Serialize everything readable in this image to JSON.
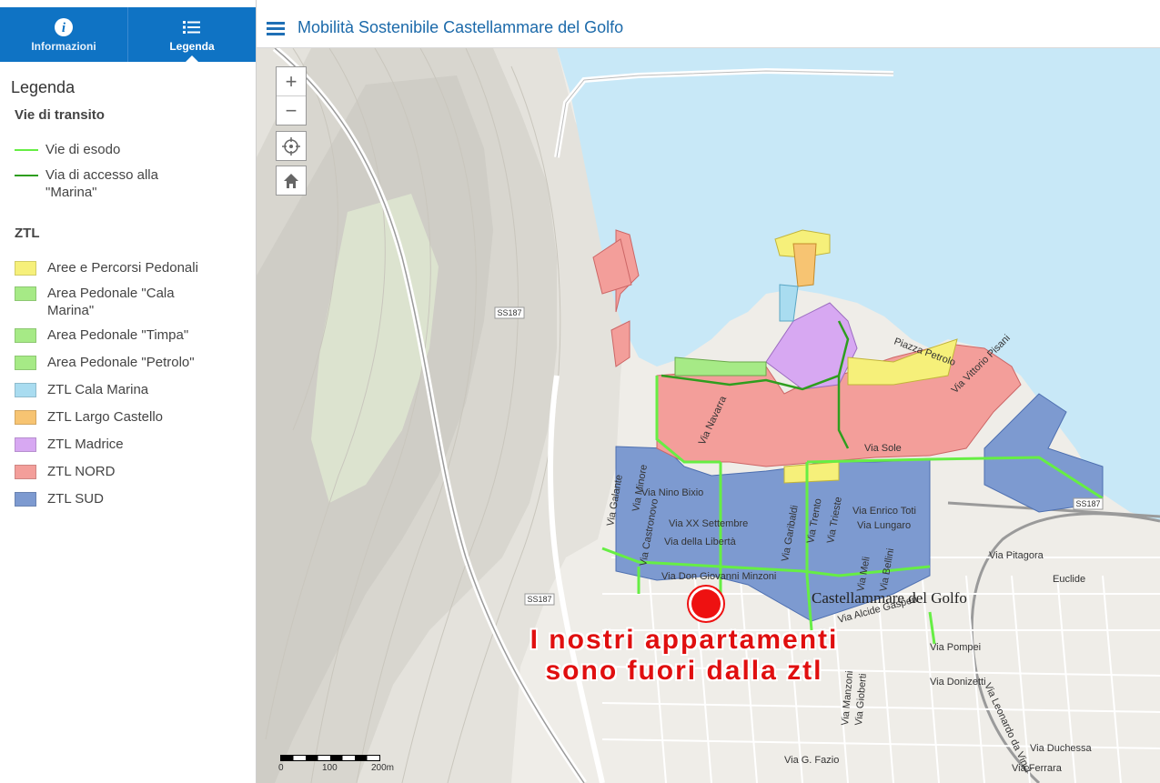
{
  "tabs": [
    {
      "label": "Informazioni",
      "icon": "info-icon"
    },
    {
      "label": "Legenda",
      "icon": "list-icon",
      "active": true
    }
  ],
  "legend": {
    "title": "Legenda",
    "section1": "Vie di transito",
    "items1": [
      {
        "label": "Vie di esodo",
        "color": "#66ee44"
      },
      {
        "label": "Via di accesso alla \"Marina\"",
        "color": "#2e9e1e"
      }
    ],
    "section2": "ZTL",
    "items2": [
      {
        "label": "Aree e Percorsi Pedonali",
        "color": "#f6f07a"
      },
      {
        "label": "Area Pedonale \"Cala Marina\"",
        "color": "#a6ea86"
      },
      {
        "label": "Area Pedonale \"Timpa\"",
        "color": "#a6ea86"
      },
      {
        "label": "Area Pedonale \"Petrolo\"",
        "color": "#a6ea86"
      },
      {
        "label": "ZTL Cala Marina",
        "color": "#a9dcf0"
      },
      {
        "label": "ZTL Largo Castello",
        "color": "#f7c472"
      },
      {
        "label": "ZTL Madrice",
        "color": "#d7a8f2"
      },
      {
        "label": "ZTL NORD",
        "color": "#f39e9a"
      },
      {
        "label": "ZTL SUD",
        "color": "#7d9ad0"
      }
    ]
  },
  "header": {
    "title": "Mobilità Sostenibile Castellammare del Golfo"
  },
  "map": {
    "town_label": "Castellammare del Golfo",
    "scale": [
      "0",
      "100",
      "200m"
    ],
    "shields": [
      "SS187",
      "SS187",
      "SS187"
    ],
    "streets": [
      "Via Nino Bixio",
      "Via XX Settembre",
      "Via della Libertà",
      "Via Don Giovanni Minzoni",
      "Via Sole",
      "Via Enrico Toti",
      "Via Lungaro",
      "Via Pitagora",
      "Euclide",
      "Via Duchessa",
      "Via Galante",
      "Via Minore",
      "Via Castronovo",
      "Via Trento",
      "Via Trieste",
      "Via Pompei",
      "Via Donizetti",
      "Via G. Fazio",
      "Via Ferrara",
      "Via Garibaldi",
      "Via Bellini",
      "Via Meli",
      "Via Vittorio Pisani",
      "Piazza Petrolo",
      "Via Navarra",
      "Via Manzoni",
      "Via Gioberti",
      "Via Alcide Gasperi",
      "Via Leonardo da Vinci"
    ],
    "annotation": [
      "I nostri appartamenti",
      "sono fuori dalla ztl"
    ]
  },
  "colors": {
    "accent": "#0f73c4",
    "sea": "#c8e8f7",
    "marker": "#ee1111"
  }
}
